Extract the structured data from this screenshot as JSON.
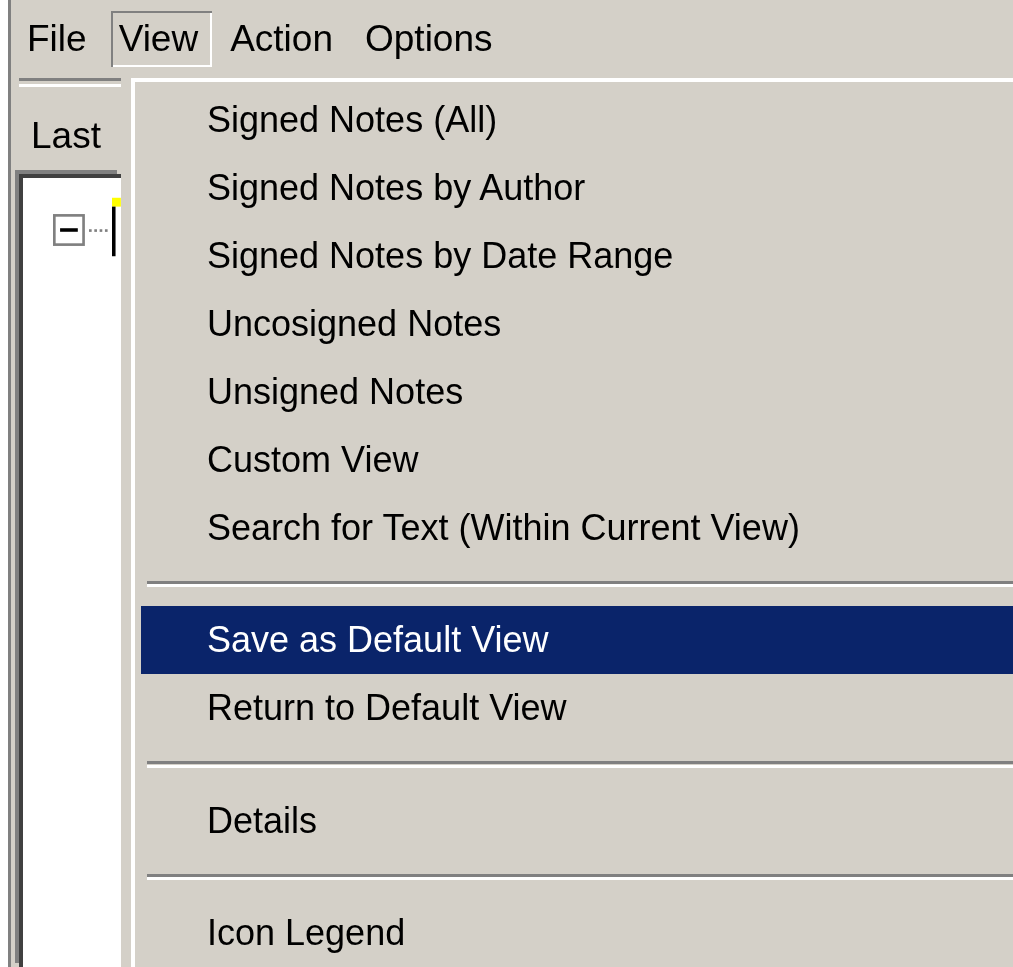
{
  "menu_bar": [
    {
      "label": "File",
      "selected": false
    },
    {
      "label": "View",
      "selected": true
    },
    {
      "label": "Action",
      "selected": false
    },
    {
      "label": "Options",
      "selected": false
    }
  ],
  "left_panel": {
    "label": "Last",
    "tree": {
      "expanded": true
    }
  },
  "view_menu": [
    {
      "kind": "item",
      "label": "Signed Notes (All)",
      "selected": false
    },
    {
      "kind": "item",
      "label": "Signed Notes by Author",
      "selected": false
    },
    {
      "kind": "item",
      "label": "Signed Notes by Date Range",
      "selected": false
    },
    {
      "kind": "item",
      "label": "Uncosigned Notes",
      "selected": false
    },
    {
      "kind": "item",
      "label": "Unsigned Notes",
      "selected": false
    },
    {
      "kind": "item",
      "label": "Custom View",
      "selected": false
    },
    {
      "kind": "item",
      "label": "Search for Text (Within Current View)",
      "selected": false
    },
    {
      "kind": "separator"
    },
    {
      "kind": "item",
      "label": "Save as Default View",
      "selected": true
    },
    {
      "kind": "item",
      "label": "Return to Default View",
      "selected": false
    },
    {
      "kind": "separator"
    },
    {
      "kind": "item",
      "label": "Details",
      "selected": false
    },
    {
      "kind": "separator"
    },
    {
      "kind": "item",
      "label": "Icon Legend",
      "selected": false
    }
  ]
}
